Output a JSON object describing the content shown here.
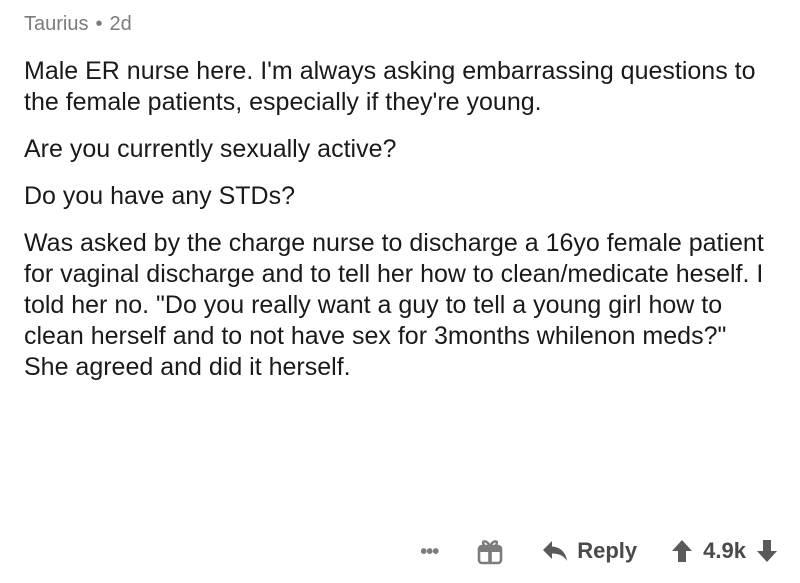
{
  "comment": {
    "author": "Taurius",
    "separator": "•",
    "age": "2d",
    "paragraphs": [
      "Male ER nurse here.  I'm always asking embarrassing questions to the female patients, especially if they're young.",
      "Are you currently sexually active?",
      "Do you have any STDs?",
      "Was asked by the charge nurse to discharge a 16yo female patient for vaginal discharge and to tell her how to clean/medicate heself.  I told her no.  \"Do you really want a guy to tell a young girl how to clean herself and to not have sex for 3months whilenon meds?\"  She agreed and did it herself."
    ],
    "actions": {
      "more_label": "•••",
      "gift_icon": "gift-icon",
      "reply_label": "Reply",
      "score": "4.9k",
      "colors": {
        "meta": "#7c7c7c",
        "text": "#1a1a1b",
        "action": "#4a4a4a"
      }
    }
  }
}
